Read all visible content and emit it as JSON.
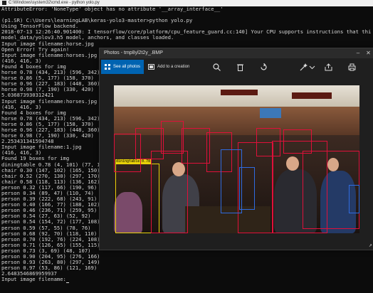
{
  "console": {
    "title": "C:\\Windows\\system32\\cmd.exe - python  yolo.py",
    "lines": [
      "AttributeError: 'NoneType' object has no attribute '__array_interface__'",
      "",
      "(p1.SR) C:\\Users\\learningLAB\\keras-yolo3-master>python yolo.py",
      "Using TensorFlow backend.",
      "2018-07-13 12:26:40.901400: I tensorflow/core/platform/cpu_feature_guard.cc:140] Your CPU supports instructions that this TensorFlow bin",
      "model_data/yolov3.h5 model, anchors, and classes loaded.",
      "Input image filename:horse.jpg",
      "Open Error! Try again!",
      "Input image filename:horses.jpg",
      "(416, 416, 3)",
      "Found 4 boxes for img",
      "horse 0.78 (434, 213) (596, 342)",
      "horse 0.86 (5, 177) (158, 370)",
      "horse 0.96 (227, 183) (448, 360)",
      "horse 0.98 (7, 190) (330, 420)",
      "5.036873930312421",
      "Input image filename:horses.jpg",
      "(416, 416, 3)",
      "Found 4 boxes for img",
      "horse 0.78 (434, 213) (596, 342)",
      "horse 0.86 (5, 177) (158, 370)",
      "horse 0.96 (227, 183) (448, 360)",
      "horse 0.98 (7, 190) (330, 420)",
      "2.253431341594748",
      "Input image filename:1.jpg",
      "(416, 416, 3)",
      "Found 19 boxes for img",
      "diningtable 0.78 (4, 101) (77, 170)",
      "chair 0.30 (147, 102) (165, 150)",
      "chair 0.52 (270, 130) (297, 170)",
      "chair 0.58 (118, 113) (136, 162)",
      "person 0.32 (117, 66) (190, 96)",
      "person 0.34 (89, 47) (110, 74)",
      "person 0.39 (222, 68) (243, 91)",
      "person 0.40 (166, 77) (188, 102)",
      "person 0.46 (236, 71) (259, 95)",
      "person 0.54 (27, 63) (52, 92)",
      "person 0.54 (154, 72) (177, 108)",
      "person 0.59 (57, 55) (78, 76)",
      "person 0.68 (92, 70) (118, 110)",
      "person 0.70 (192, 76) (224, 108)",
      "person 0.71 (126, 65) (155, 115)",
      "person 0.73 (3, 69) (48, 107)",
      "person 0.90 (204, 95) (276, 166)",
      "person 0.93 (263, 80) (297, 149)",
      "person 0.97 (53, 86) (121, 169)",
      "2.6483546869959937",
      "Input image filename:"
    ]
  },
  "photos_window": {
    "title": "Photos - tmp8yl2t2y_.BMP",
    "see_all": "See all photos",
    "add_creation": "Add to a creation",
    "toolbar_icons": [
      "zoom-icon",
      "delete-icon",
      "rotate-icon",
      "enhance-icon",
      "edit-icon",
      "share-icon",
      "print-icon",
      "more-icon"
    ],
    "box_color": "#e0103a"
  },
  "photo_labels": {
    "diningtable": "diningtable 0.78"
  }
}
